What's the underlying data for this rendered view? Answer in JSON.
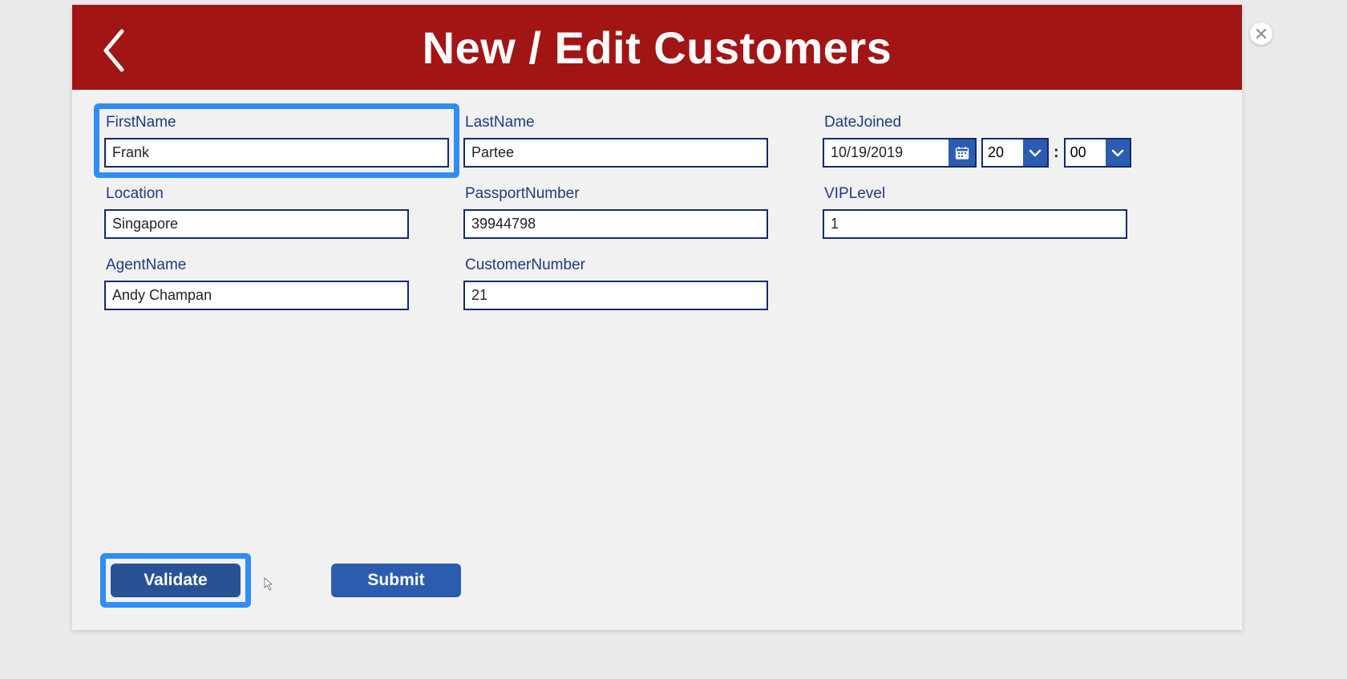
{
  "header": {
    "title": "New / Edit Customers"
  },
  "fields": {
    "firstName": {
      "label": "FirstName",
      "value": "Frank"
    },
    "lastName": {
      "label": "LastName",
      "value": "Partee"
    },
    "dateJoined": {
      "label": "DateJoined",
      "date": "10/19/2019",
      "hour": "20",
      "minute": "00"
    },
    "location": {
      "label": "Location",
      "value": "Singapore"
    },
    "passportNumber": {
      "label": "PassportNumber",
      "value": "39944798"
    },
    "vipLevel": {
      "label": "VIPLevel",
      "value": "1"
    },
    "agentName": {
      "label": "AgentName",
      "value": "Andy Champan"
    },
    "customerNumber": {
      "label": "CustomerNumber",
      "value": "21"
    }
  },
  "buttons": {
    "validate": "Validate",
    "submit": "Submit"
  }
}
